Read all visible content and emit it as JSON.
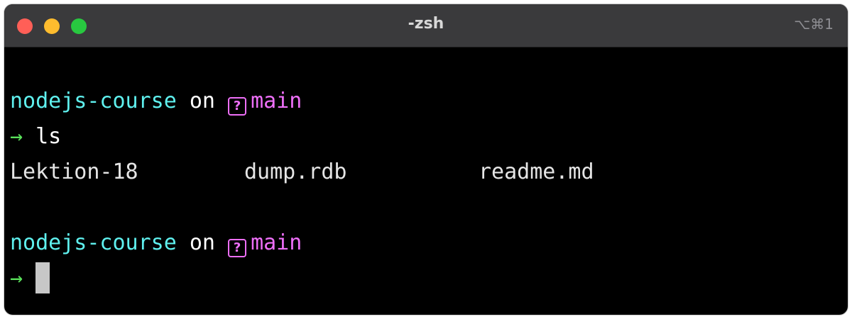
{
  "window": {
    "title": "-zsh",
    "shortcut": "⌥⌘1"
  },
  "prompt": {
    "directory": "nodejs-course",
    "connector": "on",
    "branch_icon": "?",
    "branch": "main",
    "arrow": "→"
  },
  "command": "ls",
  "ls_output": [
    "Lektion-18",
    "dump.rdb",
    "readme.md"
  ],
  "colors": {
    "directory": "#5ff0ee",
    "branch": "#ee6ff8",
    "arrow": "#59e05a",
    "background": "#000000",
    "titlebar": "#3a3a3c"
  },
  "icons": {
    "close": "close-icon",
    "minimize": "minimize-icon",
    "maximize": "maximize-icon",
    "branch": "git-branch-icon"
  }
}
